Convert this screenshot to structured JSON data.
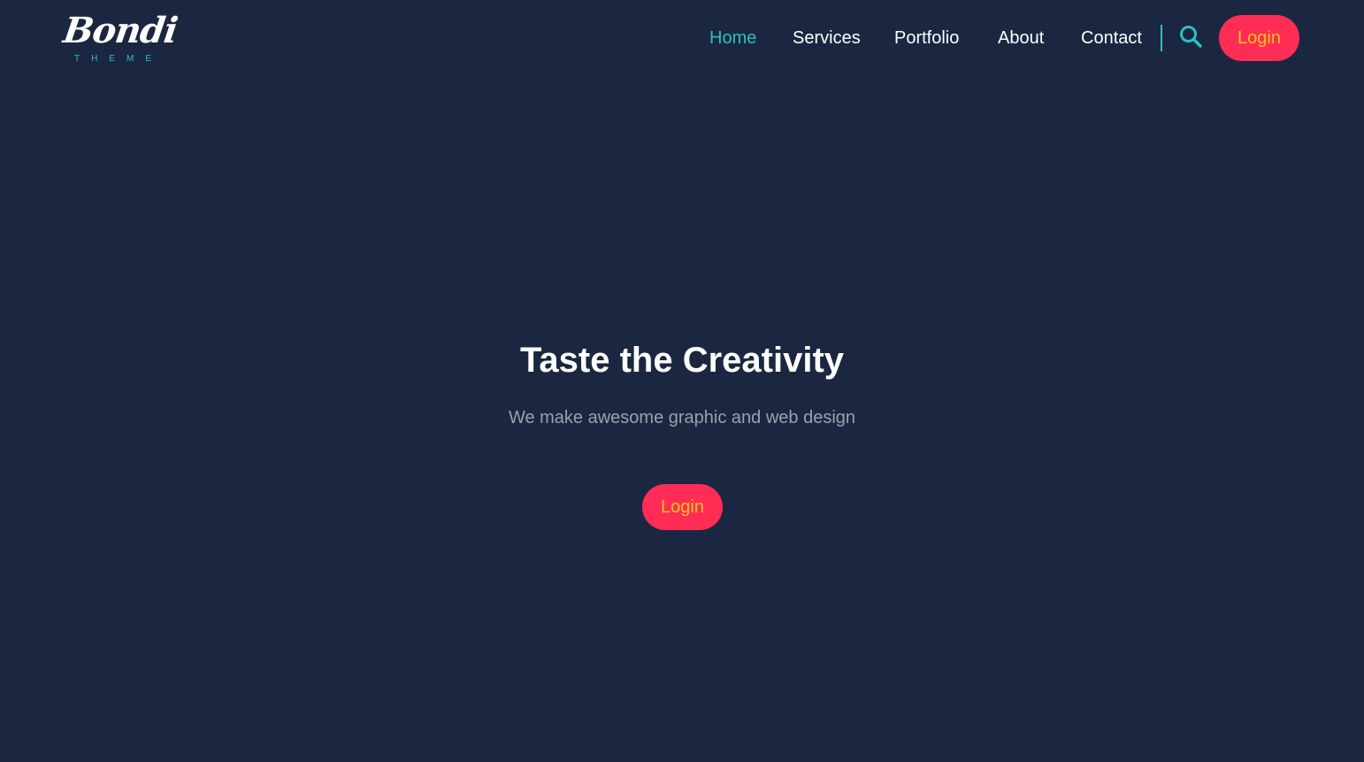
{
  "brand": {
    "logo_text": "Bondi",
    "logo_subtext": "THEME"
  },
  "nav": {
    "items": [
      {
        "label": "Home",
        "active": true
      },
      {
        "label": "Services",
        "active": false
      },
      {
        "label": "Portfolio",
        "active": false
      },
      {
        "label": "About",
        "active": false
      },
      {
        "label": "Contact",
        "active": false
      }
    ],
    "search_icon": "search-icon",
    "login_label": "Login"
  },
  "hero": {
    "title": "Taste the Creativity",
    "subtitle": "We make awesome graphic and web design",
    "login_label": "Login"
  },
  "colors": {
    "background": "#1b2740",
    "accent": "#2bc0c3",
    "button": "#ff2d55",
    "button_text": "#ffc21a",
    "muted_text": "#9aa1ad"
  }
}
